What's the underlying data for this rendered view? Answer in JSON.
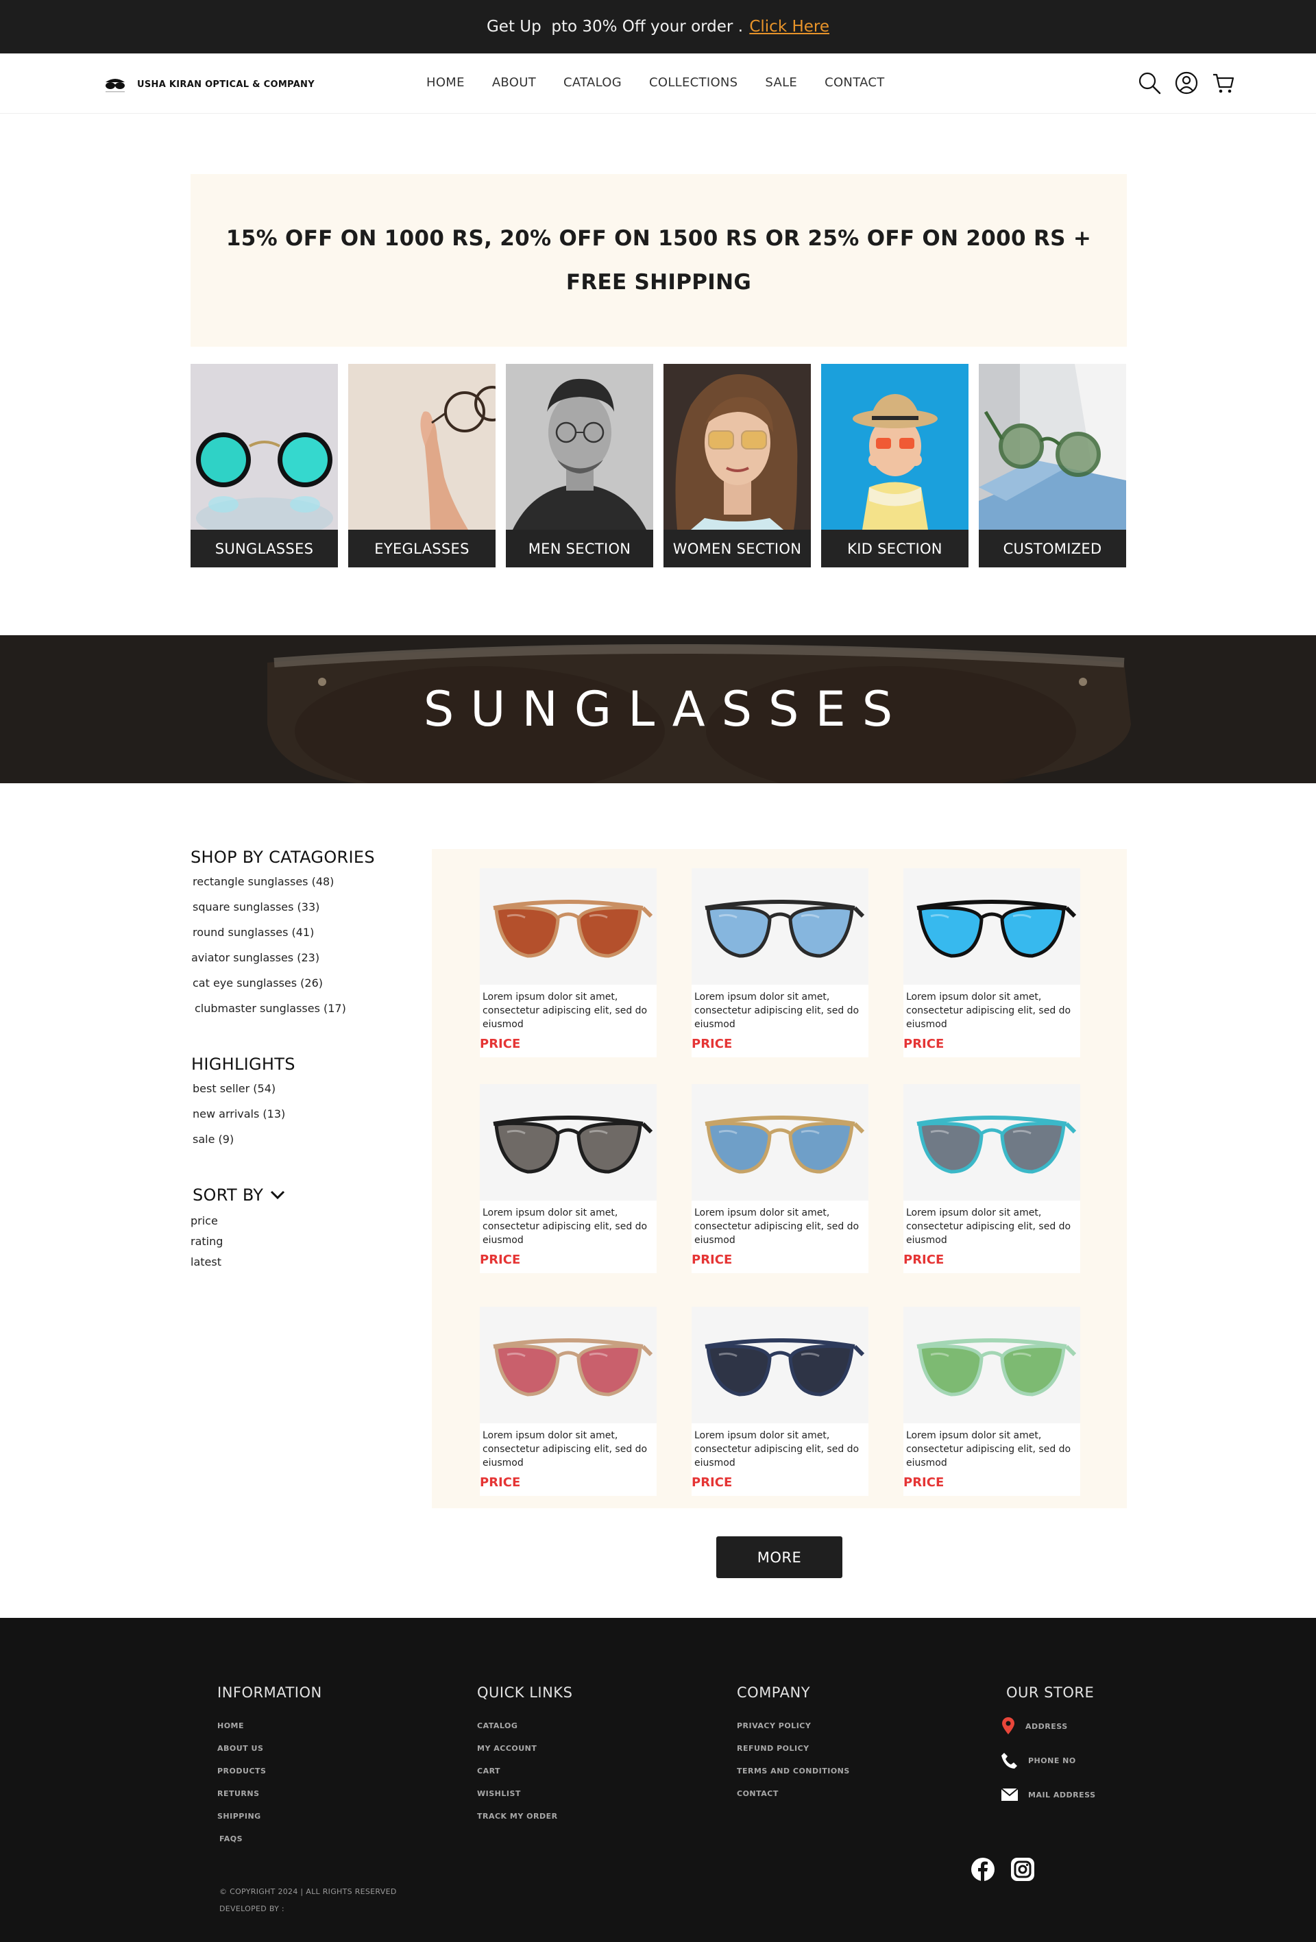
{
  "announcement": {
    "text": "Get Up  pto 30% Off your order . ",
    "link_label": "Click Here"
  },
  "brand": {
    "name": "USHA KIRAN OPTICAL & COMPANY"
  },
  "nav": [
    {
      "label": "HOME"
    },
    {
      "label": "ABOUT"
    },
    {
      "label": "CATALOG"
    },
    {
      "label": "COLLECTIONS"
    },
    {
      "label": "SALE"
    },
    {
      "label": "CONTACT"
    }
  ],
  "header_icons": [
    "search-icon",
    "account-icon",
    "cart-icon"
  ],
  "promo": {
    "line1": "15% OFF ON 1000 RS, 20% OFF ON 1500 RS OR 25% OFF ON 2000 RS +",
    "line2": "FREE SHIPPING"
  },
  "categories": [
    {
      "label": "SUNGLASSES"
    },
    {
      "label": "EYEGLASSES"
    },
    {
      "label": "MEN SECTION"
    },
    {
      "label": "WOMEN SECTION"
    },
    {
      "label": "KID SECTION"
    },
    {
      "label": "CUSTOMIZED"
    }
  ],
  "banner": {
    "title": "SUNGLASSES"
  },
  "sidebar": {
    "shop_title": "SHOP BY CATAGORIES",
    "shop_items": [
      "rectangle sunglasses (48)",
      "square sunglasses (33)",
      "round sunglasses (41)",
      "aviator sunglasses (23)",
      "cat eye sunglasses (26)",
      "clubmaster sunglasses (17)"
    ],
    "highlights_title": "HIGHLIGHTS",
    "highlight_items": [
      "best seller (54)",
      "new arrivals (13)",
      "sale (9)"
    ],
    "sort_title": "SORT BY",
    "sort_items": [
      "price",
      "rating",
      "latest"
    ]
  },
  "products": [
    {
      "desc": "Lorem ipsum dolor sit amet, consectetur adipiscing elit, sed do eiusmod",
      "price": "PRICE",
      "lens": "#b4502c",
      "frame": "#c98f62"
    },
    {
      "desc": "Lorem ipsum dolor sit amet, consectetur adipiscing elit, sed do eiusmod",
      "price": "PRICE",
      "lens": "#86b6de",
      "frame": "#2b2b2b"
    },
    {
      "desc": "Lorem ipsum dolor sit amet, consectetur adipiscing elit, sed do eiusmod",
      "price": "PRICE",
      "lens": "#37b9ee",
      "frame": "#111111"
    },
    {
      "desc": "Lorem ipsum dolor sit amet, consectetur adipiscing elit, sed do eiusmod",
      "price": "PRICE",
      "lens": "#6f6a66",
      "frame": "#1e1e1e"
    },
    {
      "desc": "Lorem ipsum dolor sit amet, consectetur adipiscing elit, sed do eiusmod",
      "price": "PRICE",
      "lens": "#6f9fc8",
      "frame": "#c6a367"
    },
    {
      "desc": "Lorem ipsum dolor sit amet, consectetur adipiscing elit, sed do eiusmod",
      "price": "PRICE",
      "lens": "#707a86",
      "frame": "#3bb8c8"
    },
    {
      "desc": "Lorem ipsum dolor sit amet, consectetur adipiscing elit, sed do eiusmod",
      "price": "PRICE",
      "lens": "#c9606c",
      "frame": "#c8a080"
    },
    {
      "desc": "Lorem ipsum dolor sit amet, consectetur adipiscing elit, sed do eiusmod",
      "price": "PRICE",
      "lens": "#2e3446",
      "frame": "#2e3b5c"
    },
    {
      "desc": "Lorem ipsum dolor sit amet, consectetur adipiscing elit, sed do eiusmod",
      "price": "PRICE",
      "lens": "#7dba72",
      "frame": "#a3d6b4"
    }
  ],
  "more_label": "MORE",
  "footer": {
    "information": {
      "title": "INFORMATION",
      "items": [
        "HOME",
        "ABOUT US",
        "PRODUCTS",
        "RETURNS",
        "SHIPPING",
        "FAQS"
      ]
    },
    "quick_links": {
      "title": "QUICK LINKS",
      "items": [
        "CATALOG",
        "MY ACCOUNT",
        "CART",
        "WISHLIST",
        "TRACK MY ORDER"
      ]
    },
    "company": {
      "title": "COMPANY",
      "items": [
        "PRIVACY POLICY",
        "REFUND POLICY",
        "TERMS AND CONDITIONS",
        "CONTACT"
      ]
    },
    "store": {
      "title": "OUR STORE",
      "address": "ADDRESS",
      "phone": "PHONE NO",
      "mail": "MAIL ADDRESS"
    },
    "copyright": "© COPYRIGHT 2024 | ALL RIGHTS RESERVED",
    "developed": "DEVELOPED BY :"
  },
  "colors": {
    "announce_bg": "#1d1d1d",
    "link": "#e8942a",
    "promo_bg": "#fdf8ef",
    "price": "#e53535",
    "footer_bg": "#131313",
    "pin": "#e8463a"
  }
}
